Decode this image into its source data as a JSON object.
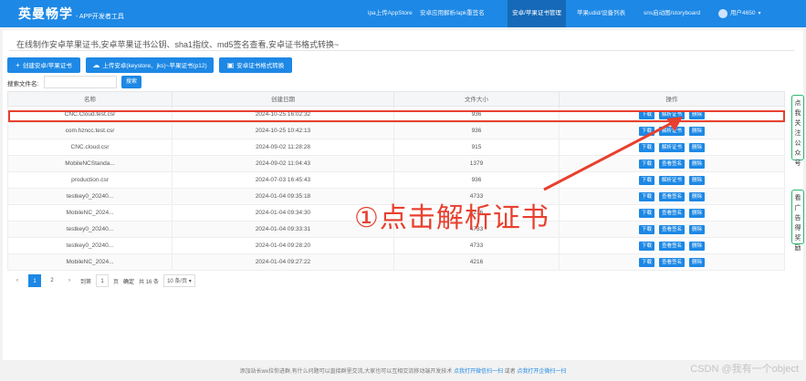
{
  "header": {
    "brand": "英曼畅学",
    "brand_sub": "- APP开发者工具",
    "nav": [
      "ipa上传AppStore",
      "安卓应用解析/apk重签名",
      "安卓/苹果证书管理",
      "苹果udid/设备列表",
      "sns启动图/storyboard"
    ],
    "user": "用户4650"
  },
  "page_title": "在线制作安卓苹果证书,安卓苹果证书公钥、sha1指纹、md5签名查看,安卓证书格式转换~",
  "toolbar": {
    "create": "创建安卓/苹果证书",
    "upload": "上传安卓(keystore、jks)~苹果证书(p12)",
    "convert": "安卓证书格式转换"
  },
  "search": {
    "label": "搜索文件名:",
    "placeholder": "",
    "button": "搜索"
  },
  "table": {
    "headers": [
      "名称",
      "创建日期",
      "文件大小",
      "操作"
    ],
    "rows": [
      {
        "name": "CNC.Cloud.test.csr",
        "date": "2024-10-25 16:02:32",
        "size": "936",
        "actions": [
          "下载",
          "解析证书",
          "删除"
        ]
      },
      {
        "name": "com.hzncc.test.csr",
        "date": "2024-10-25 10:42:13",
        "size": "936",
        "actions": [
          "下载",
          "解析证书",
          "删除"
        ]
      },
      {
        "name": "CNC.cloud.csr",
        "date": "2024-09-02 11:28:28",
        "size": "915",
        "actions": [
          "下载",
          "解析证书",
          "删除"
        ]
      },
      {
        "name": "MobileNCStanda...",
        "date": "2024-09-02 11:04:43",
        "size": "1379",
        "actions": [
          "下载",
          "查看签名",
          "删除"
        ]
      },
      {
        "name": "production.csr",
        "date": "2024-07-03 16:45:43",
        "size": "936",
        "actions": [
          "下载",
          "解析证书",
          "删除"
        ]
      },
      {
        "name": "testkey0_20240...",
        "date": "2024-01-04 09:35:18",
        "size": "4733",
        "actions": [
          "下载",
          "查看签名",
          "删除"
        ]
      },
      {
        "name": "MobileNC_2024...",
        "date": "2024-01-04 09:34:30",
        "size": "4216",
        "actions": [
          "下载",
          "查看签名",
          "删除"
        ]
      },
      {
        "name": "testkey0_20240...",
        "date": "2024-01-04 09:33:31",
        "size": "4733",
        "actions": [
          "下载",
          "查看签名",
          "删除"
        ]
      },
      {
        "name": "testkey0_20240...",
        "date": "2024-01-04 09:28:20",
        "size": "4733",
        "actions": [
          "下载",
          "查看签名",
          "删除"
        ]
      },
      {
        "name": "MobileNC_2024...",
        "date": "2024-01-04 09:27:22",
        "size": "4216",
        "actions": [
          "下载",
          "查看签名",
          "删除"
        ]
      }
    ]
  },
  "pager": {
    "prev": "‹",
    "pages": [
      "1",
      "2"
    ],
    "next": "›",
    "goto": "到第",
    "goto_value": "1",
    "page_unit": "页",
    "confirm": "确定",
    "total": "共 16 条",
    "per_page": "10 条/页"
  },
  "annotation": "①点击解析证书",
  "side_tabs": {
    "top": "点我关注公众号",
    "bottom": "看广告得奖励"
  },
  "footer": {
    "text": "添加站长wx拉你进群,有什么问题可以直接群里交流,大家也可以互相交流移动端开发技术",
    "link1": "点我打开微信扫一扫",
    "or": "或者",
    "link2": "点我打开企微扫一扫"
  },
  "watermark": "CSDN @我有一个object",
  "colors": {
    "primary": "#1d88e5",
    "annotation_red": "#e8402f",
    "side_green": "#2bb673"
  }
}
